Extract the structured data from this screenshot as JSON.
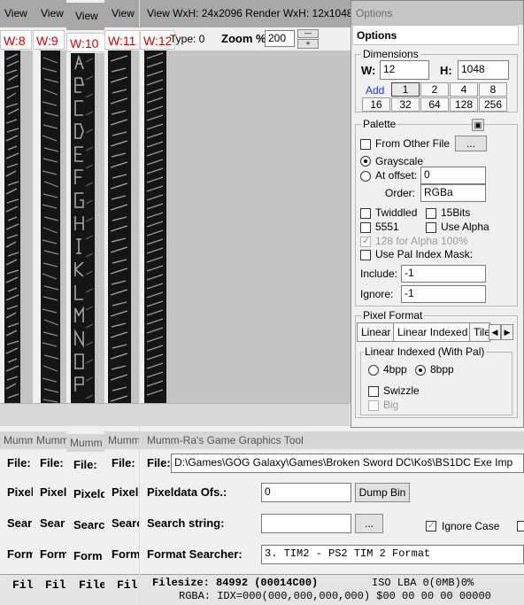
{
  "windows": [
    {
      "view_title": "View",
      "w_label": "W:8",
      "game_title": "Mumm",
      "row_labels": [
        "File:",
        "Pixel",
        "Sear",
        "Form",
        "Fil"
      ]
    },
    {
      "view_title": "View",
      "w_label": "W:9",
      "game_title": "Mumm",
      "row_labels": [
        "File:",
        "Pixeld",
        "Sear",
        "Form",
        "Fil"
      ]
    },
    {
      "view_title": "View",
      "w_label": "W:10",
      "game_title": "Mumm",
      "row_labels": [
        "File:",
        "Pixeld",
        "Searc",
        "Form",
        "File"
      ]
    },
    {
      "view_title": "View",
      "w_label": "W:11",
      "game_title": "Mumm",
      "row_labels": [
        "File:",
        "Pixelc",
        "Searc",
        "Form",
        "Fil"
      ]
    }
  ],
  "main": {
    "view_title": "View WxH: 24x2096 Render WxH: 12x1048",
    "w_label": "W:12",
    "type_label": "Type: 0",
    "zoom_label": "Zoom %:",
    "zoom_value": "200",
    "game_title": "Mumm-Ra's Game Graphics Tool",
    "file_label": "File:",
    "file_path": "D:\\Games\\GOG Galaxy\\Games\\Broken Sword DC\\Koš\\BS1DC Exe Imp",
    "pixeldata_label": "Pixeldata Ofs.:",
    "pixeldata_value": "0",
    "dump_bin": "Dump Bin",
    "search_label": "Search string:",
    "search_value": "",
    "browse_label": "...",
    "ignore_case": "Ignore Case",
    "format_label": "Format Searcher:",
    "format_value": "3. TIM2    - PS2 TIM 2 Format",
    "filesize_line": "Filesize: 84992 (00014C00)",
    "iso_line": "ISO LBA 0(0MB)0%",
    "rgba_line": "RGBA: IDX=000(000,000,000,000) $00 00 00 00 00000"
  },
  "options": {
    "title": "Options",
    "tab": "Options",
    "dimensions": {
      "label": "Dimensions",
      "w_label": "W:",
      "w_value": "12",
      "h_label": "H:",
      "h_value": "1048",
      "add_label": "Add",
      "grid": [
        "1",
        "2",
        "4",
        "8",
        "16",
        "32",
        "64",
        "128",
        "256"
      ]
    },
    "palette": {
      "label": "Palette",
      "from_other_file": "From Other File",
      "browse": "...",
      "grayscale": "Grayscale",
      "at_offset": "At offset:",
      "offset_value": "0",
      "order_label": "Order:",
      "order_value": "RGBa",
      "twiddled": "Twiddled",
      "bits15": "15Bits",
      "b5551": "5551",
      "use_alpha": "Use Alpha",
      "alpha128": "128 for Alpha 100%",
      "use_pal_mask": "Use Pal Index Mask:",
      "include_label": "Include:",
      "include_value": "-1",
      "ignore_label": "Ignore:",
      "ignore_value": "-1"
    },
    "pixel_format": {
      "label": "Pixel Format",
      "tabs": [
        "Linear",
        "Linear Indexed",
        "Tile"
      ],
      "group_label": "Linear Indexed (With Pal)",
      "bpp4": "4bpp",
      "bpp8": "8bpp",
      "swizzle": "Swizzle",
      "big": "Big"
    }
  },
  "colors": {
    "w_label_red": "#d00000",
    "title_bar_grey": "#a8a8a8",
    "preview_black": "#151515",
    "preview_glyph": "#9c9c9c",
    "add_blue": "#1a35c8"
  }
}
